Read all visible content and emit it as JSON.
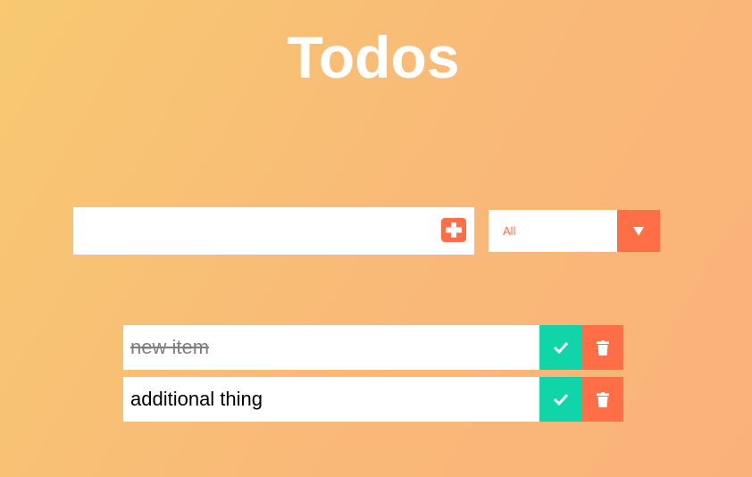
{
  "header": {
    "title": "Todos"
  },
  "form": {
    "input_value": "",
    "add_icon": "plus-square-icon",
    "filter": {
      "selected": "All",
      "toggle_icon": "caret-down-icon"
    }
  },
  "todos": [
    {
      "text": "new item",
      "completed": true
    },
    {
      "text": "additional thing",
      "completed": false
    }
  ],
  "icons": {
    "complete": "check-icon",
    "delete": "trash-icon"
  },
  "colors": {
    "accent": "#ff6f47",
    "complete": "#0fd5a8",
    "gradient_start": "#f7c971",
    "gradient_end": "#fab27a"
  }
}
